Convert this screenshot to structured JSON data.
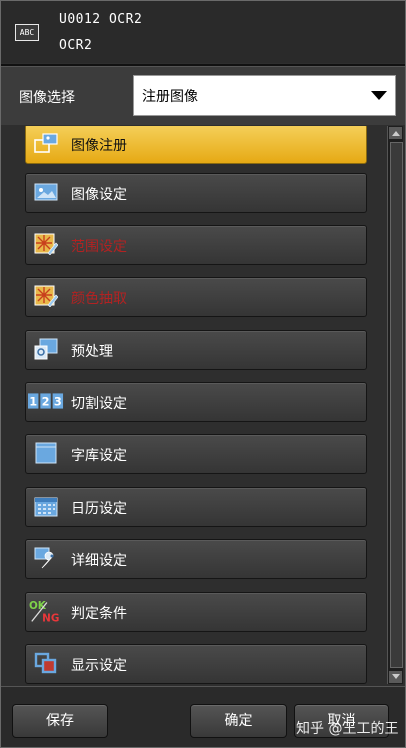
{
  "header": {
    "icon_text": "ABC",
    "line1": "U0012 OCR2",
    "line2": "OCR2"
  },
  "image_select": {
    "label": "图像选择",
    "value": "注册图像"
  },
  "menu": {
    "items": [
      {
        "label": "图像注册",
        "icon": "image-register-icon",
        "state": "active"
      },
      {
        "label": "图像设定",
        "icon": "image-settings-icon",
        "state": "normal"
      },
      {
        "label": "范围设定",
        "icon": "range-settings-icon",
        "state": "disabled"
      },
      {
        "label": "颜色抽取",
        "icon": "color-extract-icon",
        "state": "disabled"
      },
      {
        "label": "预处理",
        "icon": "preprocess-icon",
        "state": "normal"
      },
      {
        "label": "切割设定",
        "icon": "segment-123-icon",
        "state": "normal"
      },
      {
        "label": "字库设定",
        "icon": "font-library-icon",
        "state": "normal"
      },
      {
        "label": "日历设定",
        "icon": "calendar-icon",
        "state": "normal"
      },
      {
        "label": "详细设定",
        "icon": "wrench-icon",
        "state": "normal"
      },
      {
        "label": "判定条件",
        "icon": "ok-ng-icon",
        "state": "normal"
      },
      {
        "label": "显示设定",
        "icon": "display-settings-icon",
        "state": "normal"
      }
    ]
  },
  "footer": {
    "save": "保存",
    "ok": "确定",
    "cancel": "取消"
  },
  "watermark": "知乎 @王工的王",
  "colors": {
    "active_item": "#f2c23a",
    "disabled_text": "#b22222",
    "icon_blue": "#6aa8e0"
  }
}
